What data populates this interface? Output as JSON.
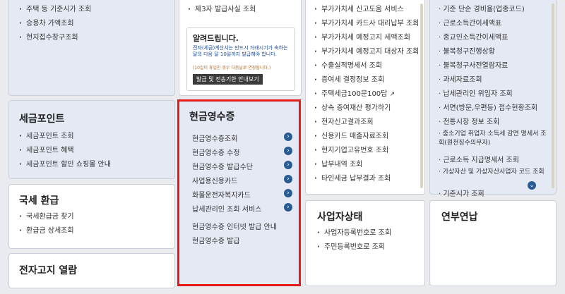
{
  "col1": {
    "top_items": [
      "주택 등 기준시가 조회",
      "승용차 가액조회",
      "현지접수창구조회"
    ],
    "points": {
      "title": "세금포인트",
      "items": [
        "세금포인트 조회",
        "세금포인트 혜택",
        "세금포인트 할인 쇼핑몰 안내"
      ]
    },
    "refund": {
      "title": "국세 환급",
      "items": [
        "국세환급금 찾기",
        "환급금 상세조회"
      ]
    },
    "bill": {
      "title": "전자고지 열람"
    }
  },
  "col2": {
    "top_item": "제3자 발급사실 조회",
    "notice": {
      "title": "알려드립니다.",
      "text1": "전자(세금)계산서는 반드시 거래시기가 속하는 달의 다음 달 10일까지 발급해야 합니다.",
      "text2": "(10일이 휴일인 경우 다음날로 연장됩니다.)",
      "button": "발급 및 전송기한 안내보기"
    },
    "cash": {
      "title": "현금영수증",
      "items": [
        "현금영수증조회",
        "현금영수증 수정",
        "현금영수증 발급수단",
        "사업용신용카드",
        "화물운전자복지카드",
        "납세관리인 조회 서비스"
      ],
      "extra_items": [
        "현금영수증 인터넷 발급 안내",
        "현금영수증 발급"
      ]
    }
  },
  "col3": {
    "items": [
      "부가가치세 신고도움 서비스",
      "부가가치세 카드사 대리납부 조회",
      "부가가치세 예정고지 세액조회",
      "부가가치세 예정고지 대상자 조회",
      "수출실적명세서 조회",
      "증여세 결정정보 조회",
      "주택세금100문100답",
      "상속 증여재산 평가하기",
      "전자신고결과조회",
      "신용카드 매출자료조회",
      "현지기업고유번호 조회",
      "납부내역 조회",
      "타인세금 납부결과 조회"
    ],
    "biz": {
      "title": "사업자상태",
      "items": [
        "사업자등록번호로 조회",
        "주민등록번호로 조회"
      ]
    }
  },
  "col4": {
    "items": [
      "기준 단순 경비율(업종코드)",
      "근로소득간이세액표",
      "종교인소득간이세액표",
      "불복청구진행상황",
      "불복청구사전열람자료",
      "과세자료조회",
      "납세관리인 위임자 조회",
      "서면(방문,우편등) 접수현황조회",
      "전통시장 정보 조회",
      "중소기업 취업자 소득세 감면 명세서 조회(원천징수의무자)",
      "근로소득 지급명세서 조회",
      "가상자산 및 가상자산사업자 코드 조회",
      "기준시가 조회"
    ],
    "yearend": {
      "title": "연부연납"
    }
  }
}
